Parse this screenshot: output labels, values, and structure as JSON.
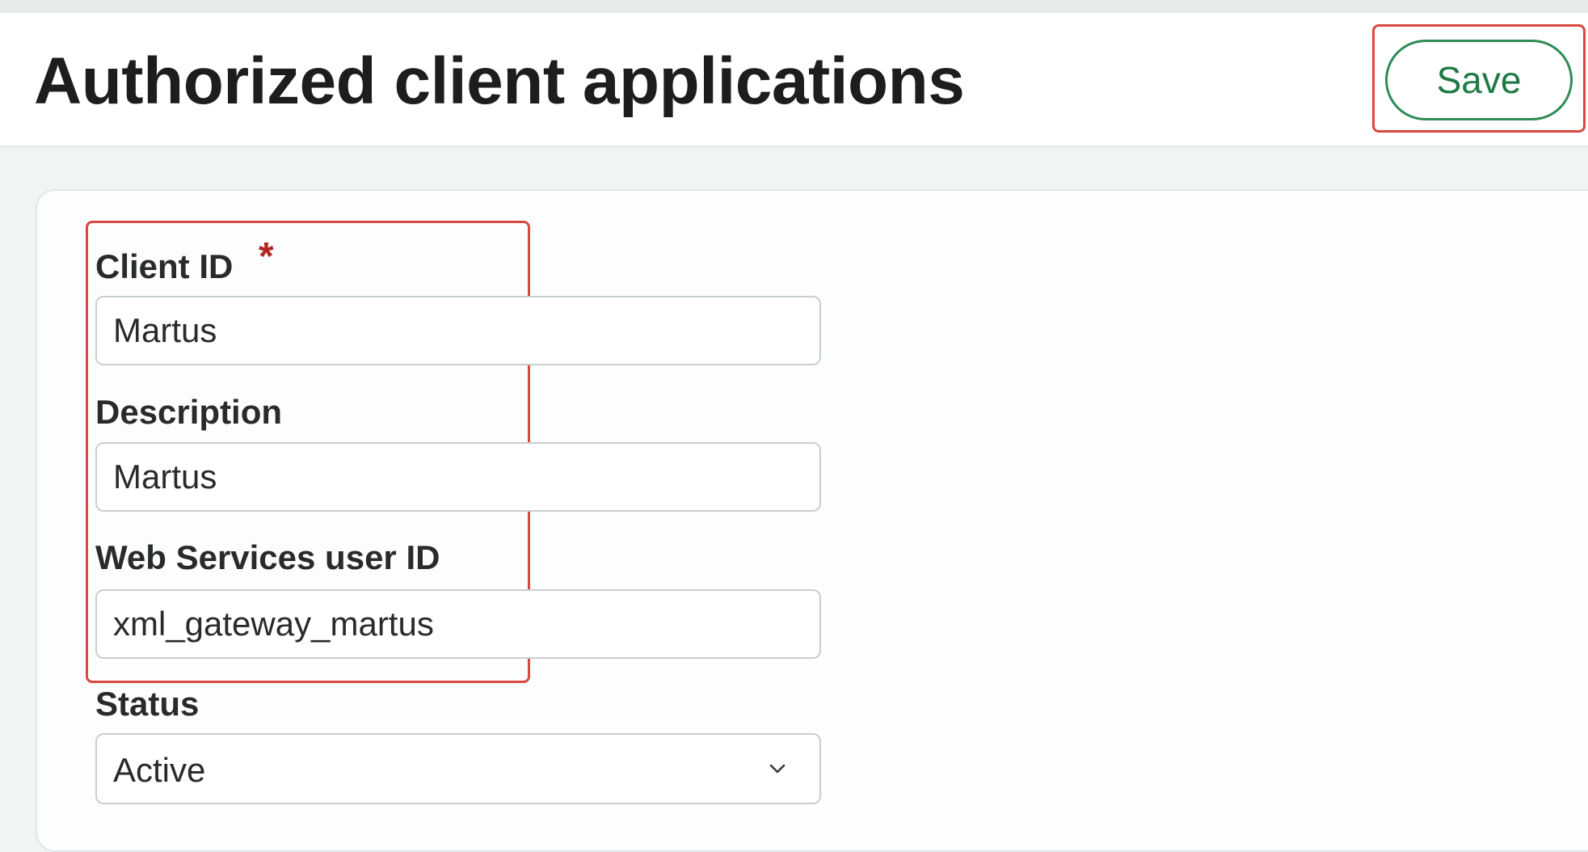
{
  "page": {
    "title": "Authorized client applications"
  },
  "toolbar": {
    "save_label": "Save"
  },
  "form": {
    "client_id": {
      "label": "Client ID",
      "required_marker": "*",
      "value": "Martus"
    },
    "description": {
      "label": "Description",
      "value": "Martus"
    },
    "ws_user_id": {
      "label": "Web Services user ID",
      "value": "xml_gateway_martus"
    },
    "status": {
      "label": "Status",
      "selected": "Active"
    }
  },
  "icons": {
    "status_dropdown": "chevron-down-icon"
  },
  "colors": {
    "save_accent": "#2e8b57",
    "highlight": "#d9493f",
    "required": "#b3261e"
  }
}
